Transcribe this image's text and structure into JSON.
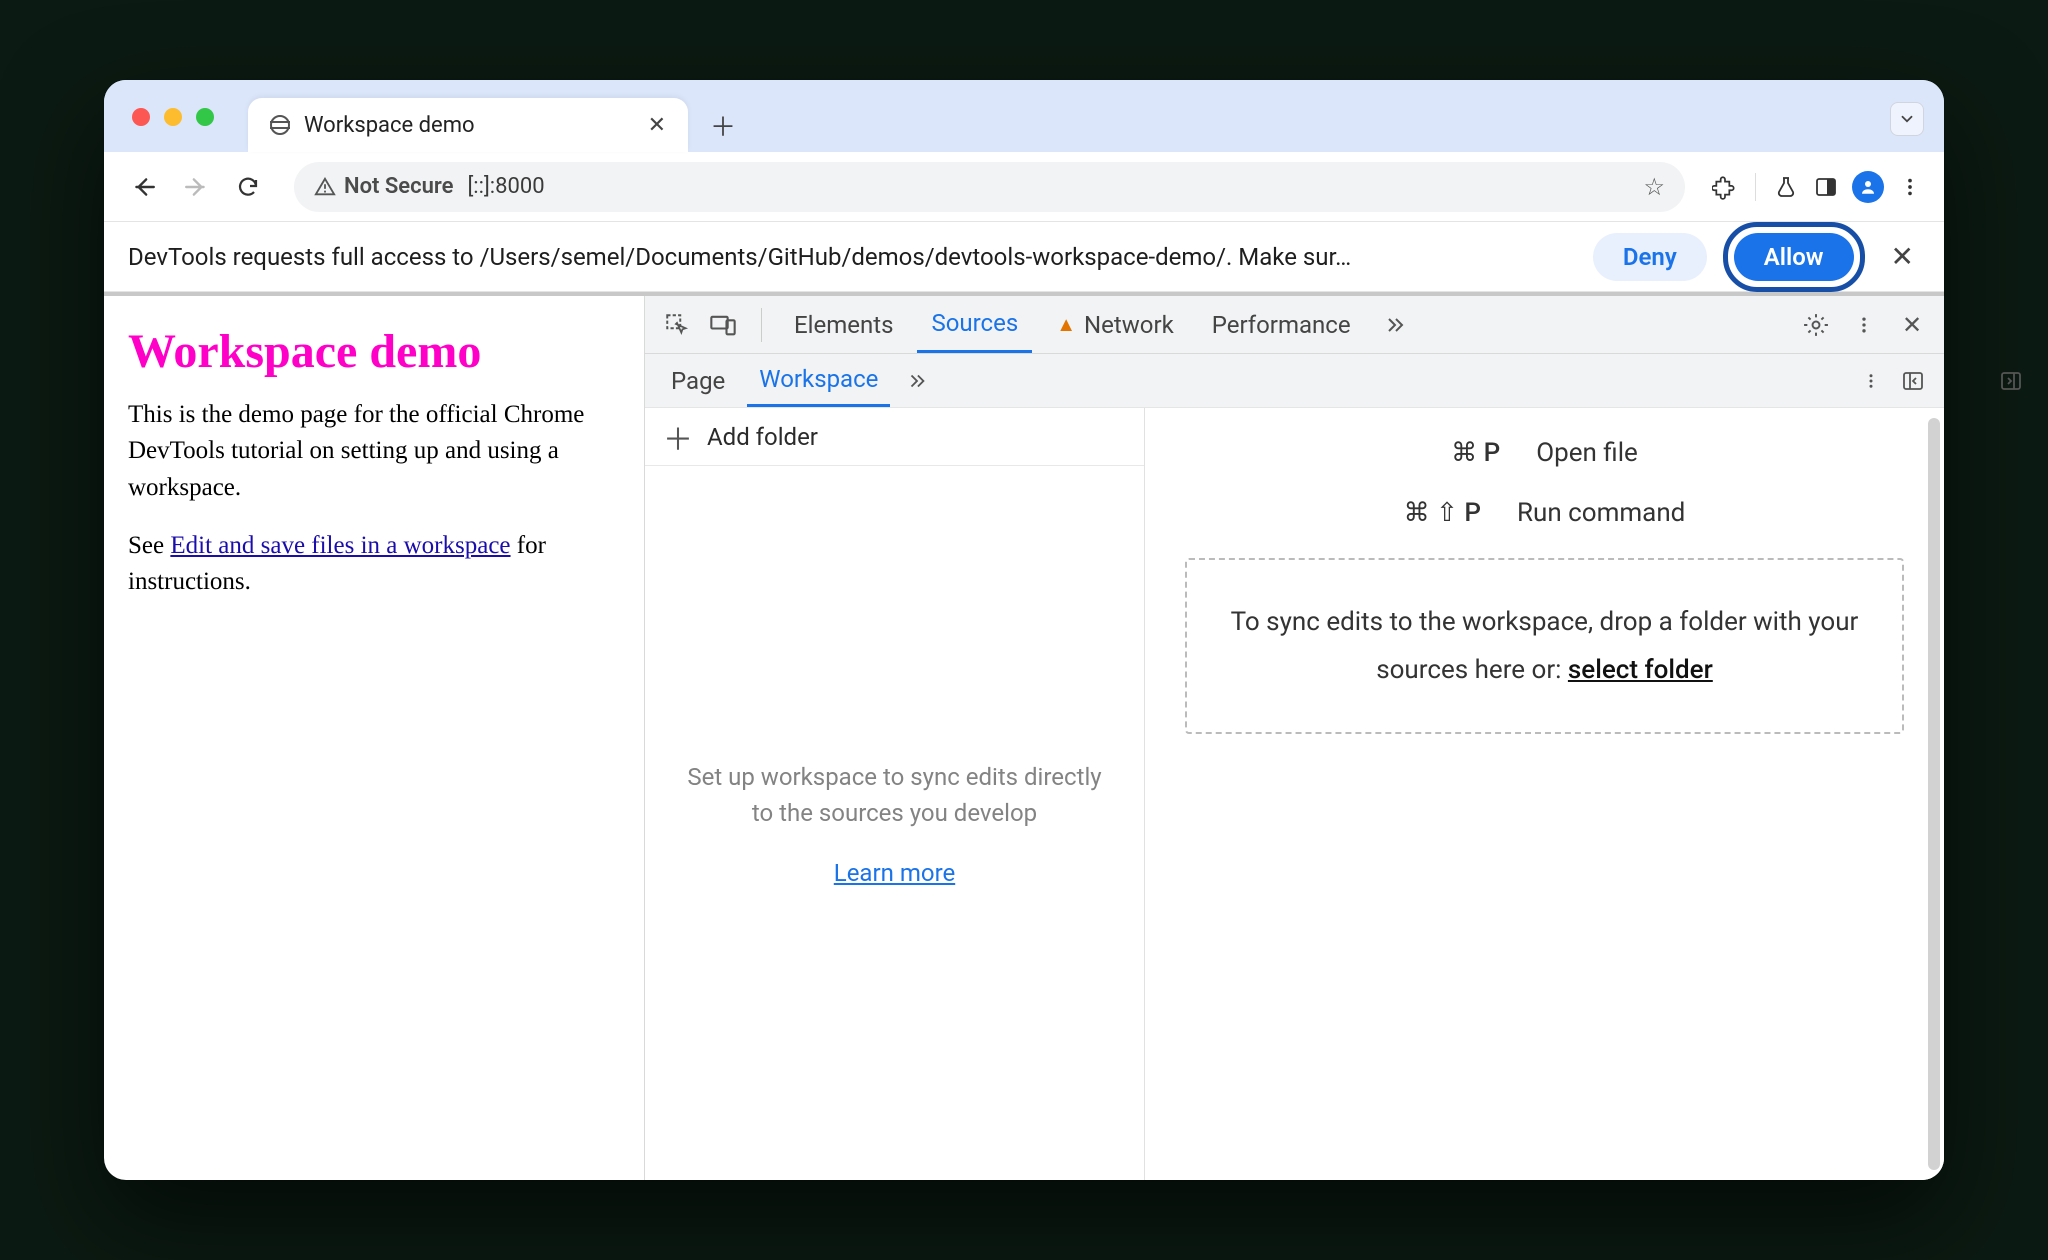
{
  "tab": {
    "title": "Workspace demo"
  },
  "omnibox": {
    "securityLabel": "Not Secure",
    "url": "[::]:8000"
  },
  "permission": {
    "message": "DevTools requests full access to /Users/semel/Documents/GitHub/demos/devtools-workspace-demo/. Make sur…",
    "deny": "Deny",
    "allow": "Allow"
  },
  "page": {
    "heading": "Workspace demo",
    "p1": "This is the demo page for the official Chrome DevTools tutorial on setting up and using a workspace.",
    "see": "See ",
    "link": "Edit and save files in a workspace",
    "afterLink": " for instructions."
  },
  "dt": {
    "tabs": {
      "elements": "Elements",
      "sources": "Sources",
      "network": "Network",
      "performance": "Performance"
    },
    "sub": {
      "page": "Page",
      "workspace": "Workspace"
    },
    "addFolder": "Add folder",
    "navHint": "Set up workspace to sync edits directly to the sources you develop",
    "learnMore": "Learn more",
    "openFileKbd": "⌘ P",
    "openFile": "Open file",
    "runCmdKbd": "⌘ ⇧ P",
    "runCmd": "Run command",
    "dropHint": "To sync edits to the workspace, drop a folder with your sources here or: ",
    "selectFolder": "select folder"
  }
}
